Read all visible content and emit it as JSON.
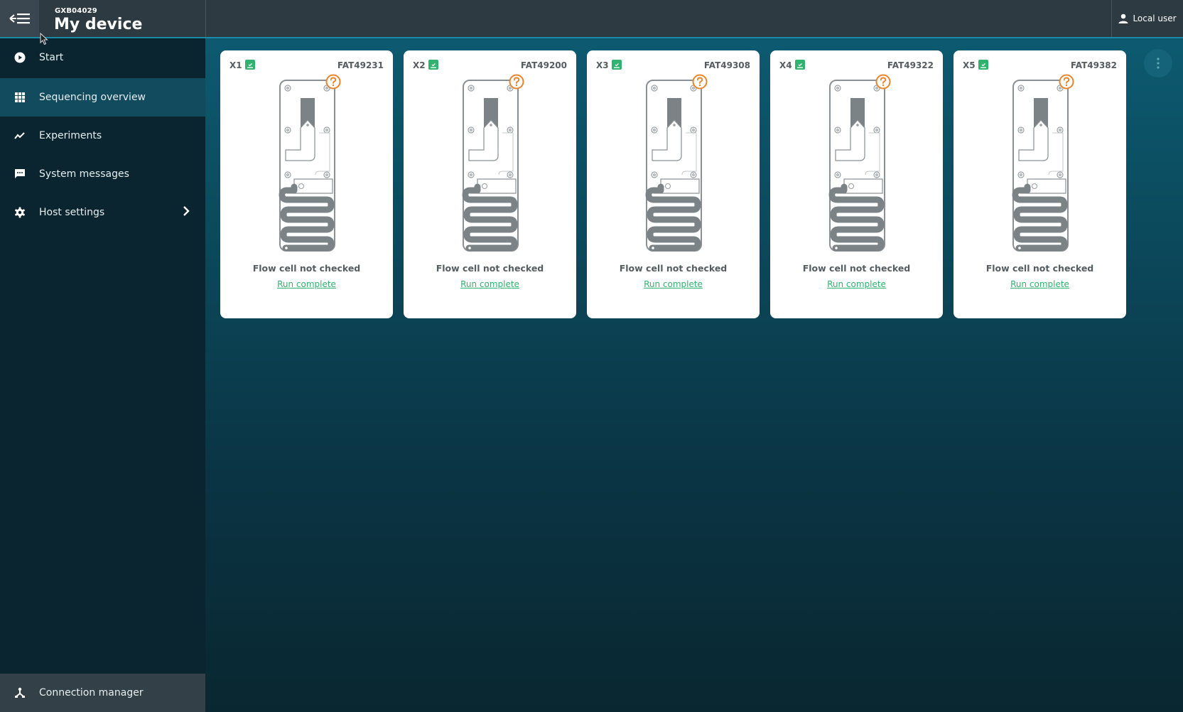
{
  "header": {
    "device_id": "GXB04029",
    "title": "My device",
    "user_label": "Local user"
  },
  "sidebar": {
    "items": [
      {
        "label": "Start",
        "icon": "play-circle-icon",
        "active": false
      },
      {
        "label": "Sequencing overview",
        "icon": "grid-icon",
        "active": true
      },
      {
        "label": "Experiments",
        "icon": "trend-line-icon",
        "active": false
      },
      {
        "label": "System messages",
        "icon": "message-icon",
        "active": false
      },
      {
        "label": "Host settings",
        "icon": "gear-icon",
        "active": false,
        "has_submenu": true
      }
    ],
    "footer_item": {
      "label": "Connection manager",
      "icon": "network-icon"
    }
  },
  "colors": {
    "accent_green": "#2fb36e",
    "help_orange": "#e8852c",
    "active_nav": "#134b5e"
  },
  "cards": [
    {
      "position": "X1",
      "flow_cell_id": "FAT49231",
      "status": "Flow cell not checked",
      "link": "Run complete"
    },
    {
      "position": "X2",
      "flow_cell_id": "FAT49200",
      "status": "Flow cell not checked",
      "link": "Run complete"
    },
    {
      "position": "X3",
      "flow_cell_id": "FAT49308",
      "status": "Flow cell not checked",
      "link": "Run complete"
    },
    {
      "position": "X4",
      "flow_cell_id": "FAT49322",
      "status": "Flow cell not checked",
      "link": "Run complete"
    },
    {
      "position": "X5",
      "flow_cell_id": "FAT49382",
      "status": "Flow cell not checked",
      "link": "Run complete"
    }
  ]
}
